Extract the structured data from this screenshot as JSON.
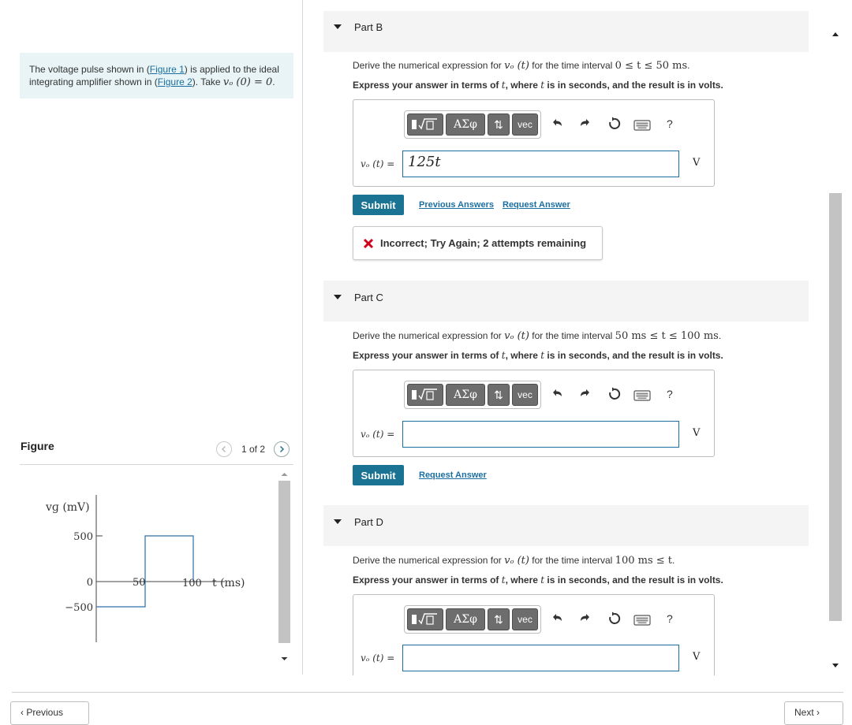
{
  "problem": {
    "text_1": "The voltage pulse shown in (",
    "figure1_link": "Figure 1",
    "text_2": ") is applied to the ideal integrating amplifier shown in (",
    "figure2_link": "Figure 2",
    "text_3": "). Take ",
    "condition": "vₒ (0) = 0",
    "text_4": "."
  },
  "figure": {
    "label": "Figure",
    "pager": "1 of 2",
    "ylabel": "vɡ (mV)",
    "xlabel": "t (ms)",
    "tick_500": "500",
    "tick_0": "0",
    "tick_neg500": "−500",
    "tick_50": "50",
    "tick_100": "100"
  },
  "toolbar": {
    "template_icon": "template-sqrt-icon",
    "greek": "ΑΣφ",
    "arrows": "⇅",
    "vec": "vec",
    "undo_icon": "undo-icon",
    "redo_icon": "redo-icon",
    "reset_icon": "reset-icon",
    "keyboard_icon": "keyboard-icon",
    "help": "?"
  },
  "parts": [
    {
      "title": "Part B",
      "prompt_pre": "Derive the numerical expression for ",
      "func": "vₒ (t)",
      "prompt_mid": " for the time interval ",
      "interval": "0 ≤ t ≤ 50 ms",
      "prompt_post": ".",
      "express": "Express your answer in terms of ",
      "express_var": "t",
      "express_post": ", where ",
      "express_var2": "t",
      "express_end": " is in seconds, and the result is in volts.",
      "eq_label": "vₒ (t) =",
      "answer": "125t",
      "unit": "V",
      "submit": "Submit",
      "link1": "Previous Answers",
      "link2": "Request Answer",
      "feedback": "Incorrect; Try Again; 2 attempts remaining"
    },
    {
      "title": "Part C",
      "prompt_pre": "Derive the numerical expression for ",
      "func": "vₒ (t)",
      "prompt_mid": " for the time interval ",
      "interval": "50 ms ≤ t ≤ 100 ms",
      "prompt_post": ".",
      "express": "Express your answer in terms of ",
      "express_var": "t",
      "express_post": ", where ",
      "express_var2": "t",
      "express_end": " is in seconds, and the result is in volts.",
      "eq_label": "vₒ (t) =",
      "answer": "",
      "unit": "V",
      "submit": "Submit",
      "link2": "Request Answer"
    },
    {
      "title": "Part D",
      "prompt_pre": "Derive the numerical expression for ",
      "func": "vₒ (t)",
      "prompt_mid": " for the time interval ",
      "interval": "100 ms ≤ t",
      "prompt_post": ".",
      "express": "Express your answer in terms of ",
      "express_var": "t",
      "express_post": ", where ",
      "express_var2": "t",
      "express_end": " is in seconds, and the result is in volts.",
      "eq_label": "vₒ (t) =",
      "answer": "",
      "unit": "V"
    }
  ],
  "nav": {
    "previous": "‹ Previous",
    "next": "Next ›"
  },
  "colors": {
    "accent": "#1a7392",
    "link": "#1b6fa0",
    "error": "#d0021b",
    "problem_bg": "#e8f4f6",
    "plot_line": "#2e6fa6"
  }
}
